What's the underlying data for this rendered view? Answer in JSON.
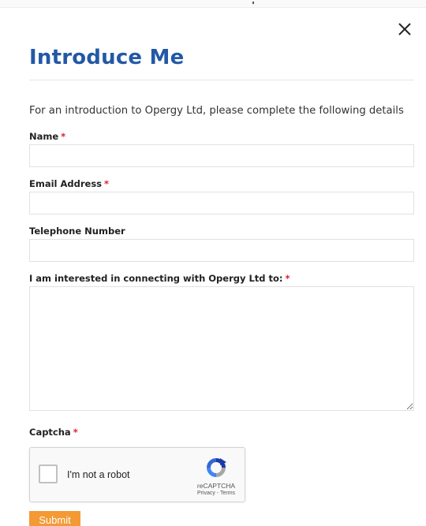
{
  "dialog": {
    "title": "Introduce Me",
    "intro": "For an introduction to Opergy Ltd, please complete the following details"
  },
  "form": {
    "required_marker": "*",
    "fields": {
      "name": {
        "label": "Name",
        "value": ""
      },
      "email": {
        "label": "Email Address",
        "value": ""
      },
      "telephone": {
        "label": "Telephone Number",
        "value": ""
      },
      "interest": {
        "label": "I am interested in connecting with Opergy Ltd to:",
        "value": ""
      },
      "captcha": {
        "label": "Captcha"
      }
    }
  },
  "recaptcha": {
    "checkbox_label": "I'm not a robot",
    "brand": "reCAPTCHA",
    "privacy": "Privacy",
    "separator": " - ",
    "terms": "Terms",
    "checked": false
  },
  "submit": {
    "label": "Submit"
  },
  "icons": {
    "close": "close-icon",
    "recaptcha_logo": "recaptcha-logo-icon"
  },
  "colors": {
    "title": "#2358a6",
    "required": "#d9232d",
    "submit_bg": "#f39a35",
    "submit_text": "#ffffff"
  }
}
